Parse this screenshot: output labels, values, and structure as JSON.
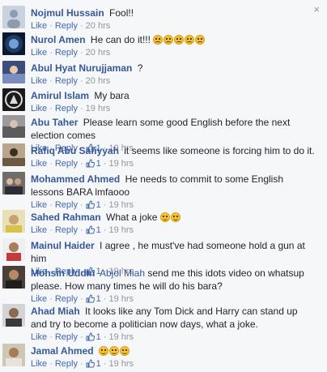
{
  "close_glyph": "×",
  "meta_labels": {
    "like": "Like",
    "reply": "Reply",
    "dot": "·"
  },
  "comments": [
    {
      "name": "Nojmul Hussain",
      "text": "Fool!!",
      "time": "20 hrs",
      "likes": null
    },
    {
      "name": "Nurol Amen",
      "text": "He can do it!!!",
      "emoji": "crying-faces",
      "emoji_count": 5,
      "time": "20 hrs",
      "likes": null
    },
    {
      "name": "Abul Hyat Nurujjaman",
      "text": "?",
      "time": "20 hrs",
      "likes": null
    },
    {
      "name": "Amirul Islam",
      "text": "My bara",
      "time": "19 hrs",
      "likes": null
    },
    {
      "name": "Abu Taher",
      "text": "Please learn some good English before the next election comes",
      "time": "19 hrs",
      "likes": "1"
    },
    {
      "name": "Rafiq Abu Safiyyah",
      "text": "it seems like someone is forcing him to do it.",
      "time": "19 hrs",
      "likes": "1"
    },
    {
      "name": "Mohammed Ahmed",
      "text": "He needs to commit to some English lessons BARA lmfaooo",
      "time": "19 hrs",
      "likes": "1"
    },
    {
      "name": "Sahed Rahman",
      "text": "What a joke",
      "emoji": "laughing-faces",
      "emoji_count": 2,
      "time": "19 hrs",
      "likes": "1"
    },
    {
      "name": "Mainul Haider",
      "text": "I agree , he must've had someone hold a gun at him",
      "time": "19 hrs",
      "likes": "1"
    },
    {
      "name": "Mohsin Uddin",
      "mention": "Abjol Miah",
      "text": "send me this idots video on whatsup please. How many times he will do his bara?",
      "time": "19 hrs",
      "likes": "1"
    },
    {
      "name": "Ahad Miah",
      "text": "It looks like any Tom Dick and Harry can stand up and try to become a politician now days, what a joke.",
      "time": "19 hrs",
      "likes": "1"
    },
    {
      "name": "Jamal Ahmed",
      "text": "",
      "emoji": "laughing-faces",
      "emoji_count": 3,
      "time": "19 hrs",
      "likes": "1"
    }
  ]
}
